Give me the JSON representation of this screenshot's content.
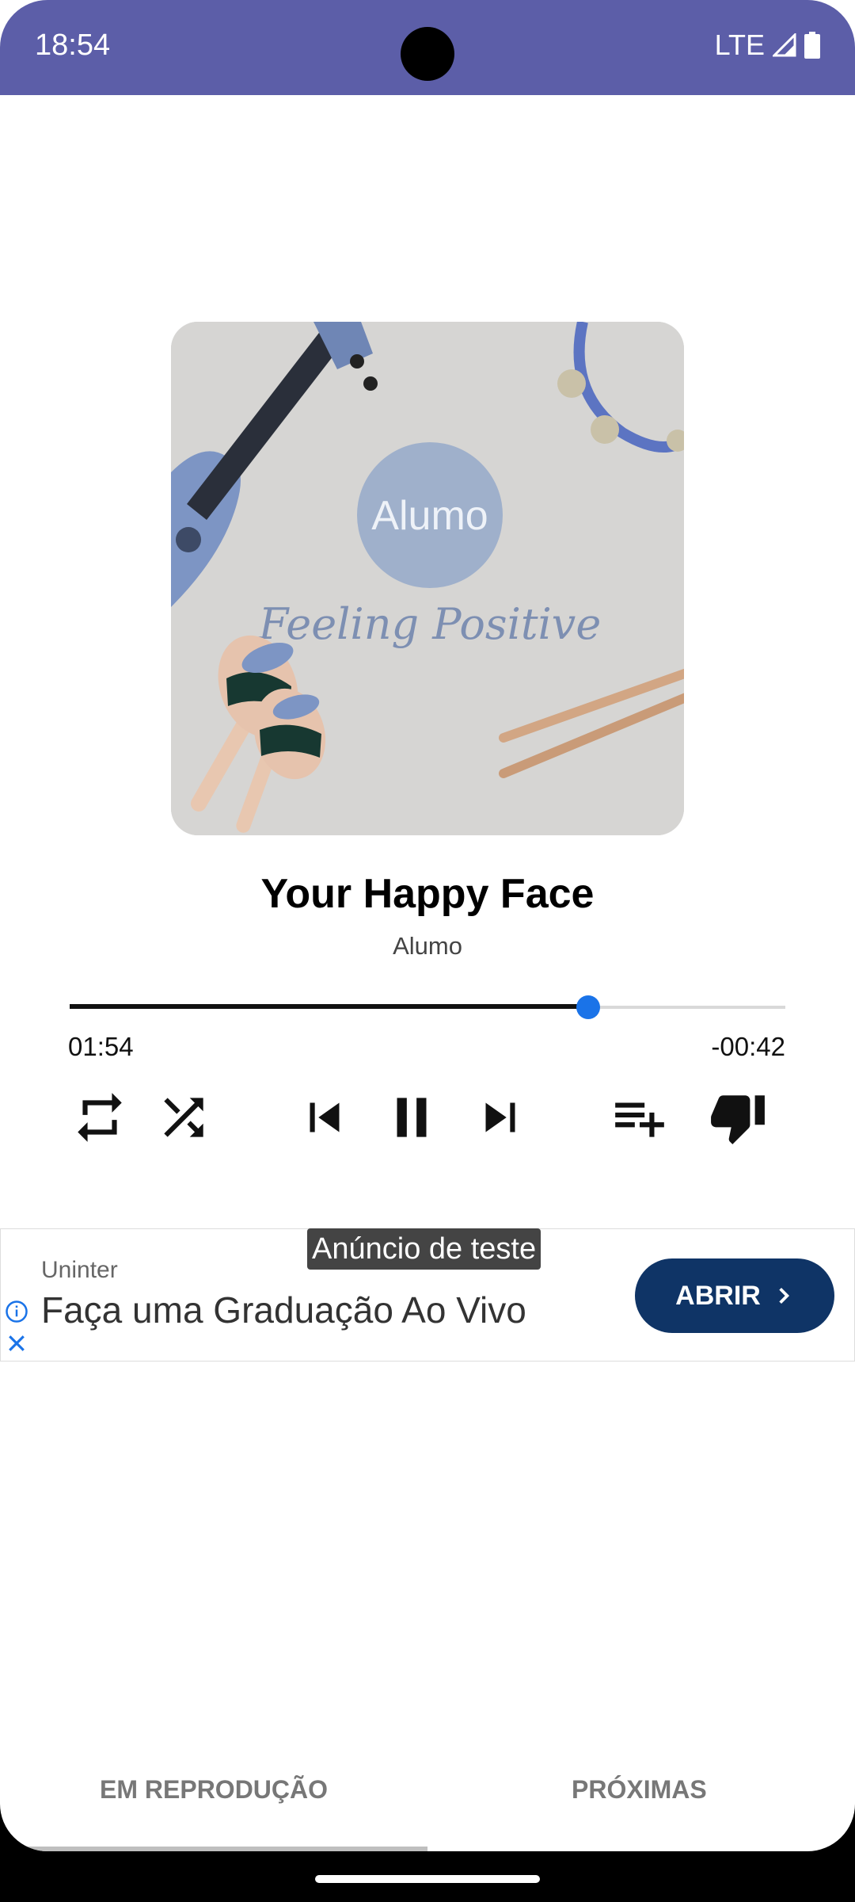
{
  "status_bar": {
    "time": "18:54",
    "network": "LTE"
  },
  "album_art": {
    "artist_badge": "Alumo",
    "album_title": "Feeling Positive"
  },
  "track": {
    "title": "Your Happy Face",
    "artist": "Alumo"
  },
  "playback": {
    "elapsed": "01:54",
    "remaining": "-00:42",
    "progress": 0.725,
    "state": "playing"
  },
  "controls": {
    "repeat_icon": "repeat-icon",
    "shuffle_icon": "shuffle-icon",
    "previous_icon": "skip-previous-icon",
    "pause_icon": "pause-icon",
    "next_icon": "skip-next-icon",
    "add_to_queue_icon": "playlist-add-icon",
    "dislike_icon": "thumb-down-icon"
  },
  "ad": {
    "badge": "Anúncio de teste",
    "advertiser": "Uninter",
    "headline": "Faça uma Graduação Ao Vivo",
    "cta": "ABRIR"
  },
  "tabs": [
    {
      "label": "EM REPRODUÇÃO",
      "selected": true
    },
    {
      "label": "PRÓXIMAS",
      "selected": false
    }
  ],
  "colors": {
    "status_bar": "#5c5ea8",
    "seek_thumb": "#1a73e8",
    "ad_cta": "#0f3466"
  }
}
